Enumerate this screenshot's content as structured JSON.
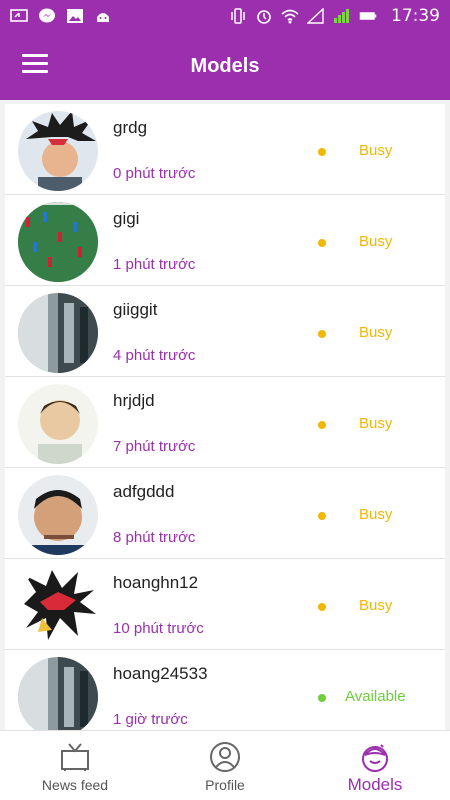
{
  "status_bar": {
    "time": "17:39"
  },
  "header": {
    "title": "Models"
  },
  "models": [
    {
      "name": "grdg",
      "last_seen": "0 phút trước",
      "status": "Busy",
      "status_color": "#f2b700",
      "avatar": "yugi"
    },
    {
      "name": "gigi",
      "last_seen": "1 phút trước",
      "status": "Busy",
      "status_color": "#f2b700",
      "avatar": "foosball"
    },
    {
      "name": "giiggit",
      "last_seen": "4 phút trước",
      "status": "Busy",
      "status_color": "#f2b700",
      "avatar": "room"
    },
    {
      "name": "hrjdjd",
      "last_seen": "7 phút trước",
      "status": "Busy",
      "status_color": "#f2b700",
      "avatar": "person-light"
    },
    {
      "name": "adfgddd",
      "last_seen": "8 phút trước",
      "status": "Busy",
      "status_color": "#f2b700",
      "avatar": "person-dark"
    },
    {
      "name": "hoanghn12",
      "last_seen": "10 phút trước",
      "status": "Busy",
      "status_color": "#f2b700",
      "avatar": "yugi-hair"
    },
    {
      "name": "hoang24533",
      "last_seen": "1 giờ trước",
      "status": "Available",
      "status_color": "#6ccf3a",
      "avatar": "room"
    }
  ],
  "bottom_nav": [
    {
      "label": "News feed",
      "icon": "tv-icon"
    },
    {
      "label": "Profile",
      "icon": "profile-icon"
    },
    {
      "label": "Models",
      "icon": "models-icon",
      "active": true
    }
  ],
  "colors": {
    "brand": "#9b2fae",
    "busy": "#f2b700",
    "available": "#6ccf3a"
  }
}
